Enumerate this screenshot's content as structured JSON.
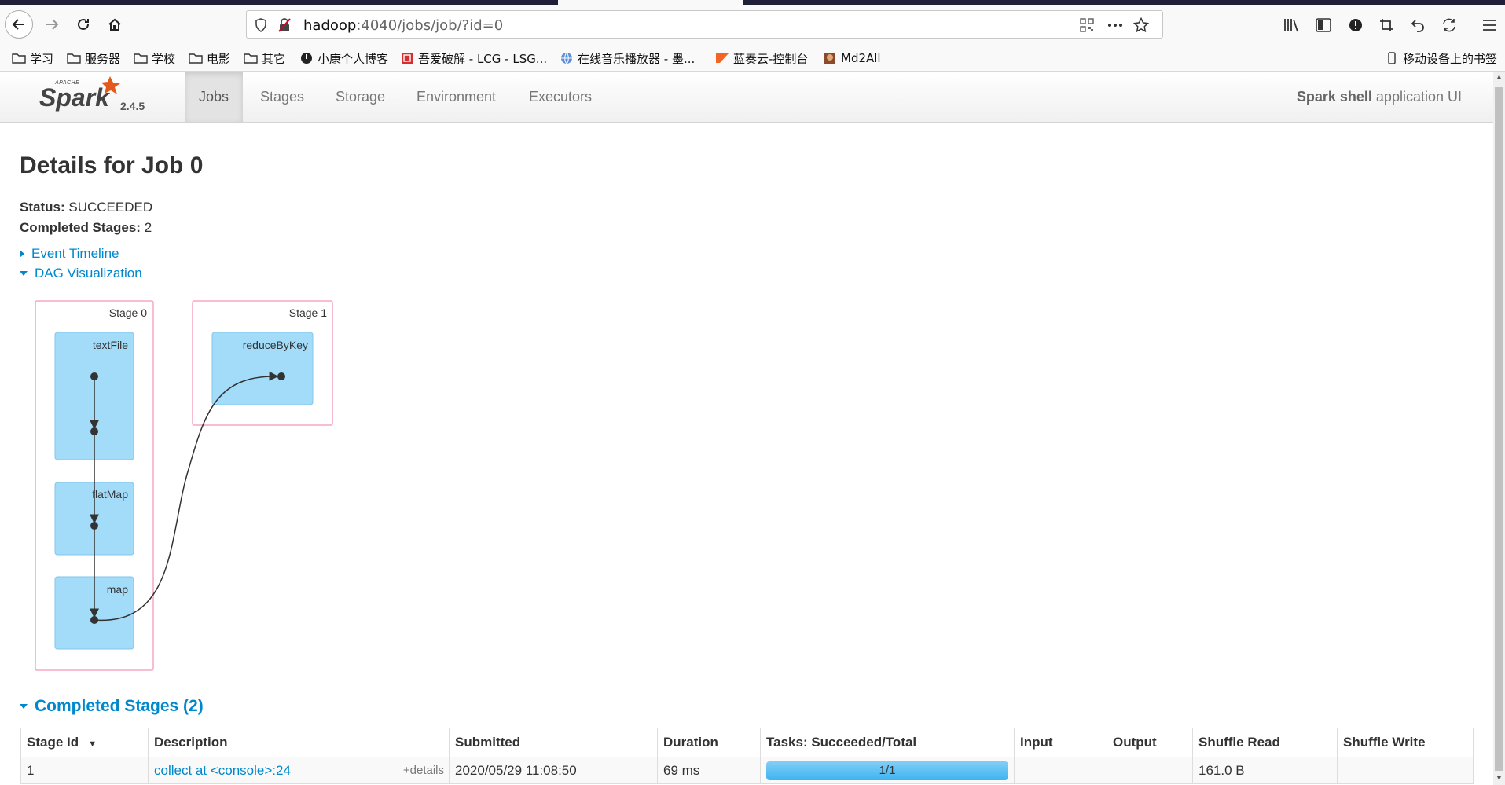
{
  "browser": {
    "url_host": "hadoop",
    "url_rest": ":4040/jobs/job/?id=0",
    "bookmarks": [
      {
        "label": "学习",
        "icon": "folder-icon"
      },
      {
        "label": "服务器",
        "icon": "folder-icon"
      },
      {
        "label": "学校",
        "icon": "folder-icon"
      },
      {
        "label": "电影",
        "icon": "folder-icon"
      },
      {
        "label": "其它",
        "icon": "folder-icon"
      },
      {
        "label": "小康个人博客",
        "icon": "site-icon"
      },
      {
        "label": "吾爱破解 - LCG - LSG...",
        "icon": "site-icon"
      },
      {
        "label": "在线音乐播放器 - 墨...",
        "icon": "globe-icon"
      },
      {
        "label": "蓝奏云-控制台",
        "icon": "site-icon"
      },
      {
        "label": "Md2All",
        "icon": "site-icon"
      }
    ],
    "mobile_bookmarks": "移动设备上的书签"
  },
  "spark": {
    "version": "2.4.5",
    "tabs": [
      "Jobs",
      "Stages",
      "Storage",
      "Environment",
      "Executors"
    ],
    "active_tab": "Jobs",
    "app_name": "Spark shell",
    "app_suffix": " application UI"
  },
  "job": {
    "title": "Details for Job 0",
    "status_label": "Status:",
    "status_value": "SUCCEEDED",
    "completed_label": "Completed Stages:",
    "completed_value": "2",
    "event_timeline": "Event Timeline",
    "dag_visualization": "DAG Visualization"
  },
  "dag": {
    "stages": [
      {
        "label": "Stage 0",
        "ops": [
          "textFile",
          "flatMap",
          "map"
        ]
      },
      {
        "label": "Stage 1",
        "ops": [
          "reduceByKey"
        ]
      }
    ]
  },
  "completed_stages": {
    "title": "Completed Stages (2)",
    "columns": [
      "Stage Id",
      "Description",
      "Submitted",
      "Duration",
      "Tasks: Succeeded/Total",
      "Input",
      "Output",
      "Shuffle Read",
      "Shuffle Write"
    ],
    "rows": [
      {
        "stage_id": "1",
        "description": "collect at <console>:24",
        "details": "+details",
        "submitted": "2020/05/29 11:08:50",
        "duration": "69 ms",
        "tasks": "1/1",
        "tasks_fraction": 1.0,
        "input": "",
        "output": "",
        "shuffle_read": "161.0 B",
        "shuffle_write": ""
      }
    ]
  },
  "colors": {
    "link": "#0088cc",
    "dag_node": "#a3dcf9",
    "stage_border": "#f5a8c1"
  }
}
